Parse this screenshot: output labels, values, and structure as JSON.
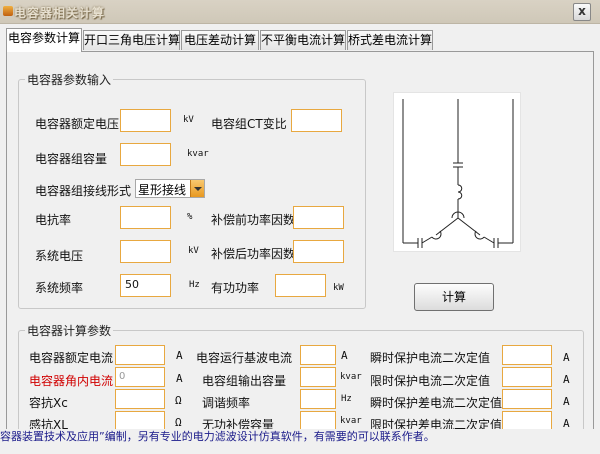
{
  "window": {
    "title": "电容器相关计算",
    "close_label": "x"
  },
  "tabs": [
    "电容参数计算",
    "开口三角电压计算",
    "电压差动计算",
    "不平衡电流计算",
    "桥式差电流计算"
  ],
  "input_group": {
    "legend": "电容器参数输入",
    "rated_voltage_label": "电容器额定电压",
    "rated_voltage_unit": "kV",
    "ct_ratio_label": "电容组CT变比",
    "capacity_label": "电容器组容量",
    "capacity_unit": "kvar",
    "wiring_label": "电容器组接线形式",
    "wiring_value": "星形接线",
    "reactance_label": "电抗率",
    "reactance_unit": "%",
    "pf_before_label": "补偿前功率因数",
    "system_voltage_label": "系统电压",
    "system_voltage_unit": "kV",
    "pf_after_label": "补偿后功率因数",
    "frequency_label": "系统频率",
    "frequency_value": "50",
    "frequency_unit": "Hz",
    "active_power_label": "有功功率",
    "active_power_unit": "kW"
  },
  "calc_button": "计算",
  "output_group": {
    "legend": "电容器计算参数",
    "rated_current_label": "电容器额定电流",
    "rated_current_unit": "A",
    "fundamental_current_label": "电容运行基波电流",
    "fundamental_current_unit": "A",
    "instant_second_label": "瞬时保护电流二次定值",
    "instant_second_unit": "A",
    "angle_current_label": "电容器角内电流",
    "angle_current_value": "0",
    "angle_current_unit": "A",
    "group_output_label": "电容组输出容量",
    "group_output_unit": "kvar",
    "limit_second_label": "限时保护电流二次定值",
    "limit_second_unit": "A",
    "xc_label": "容抗Xc",
    "xc_unit": "Ω",
    "tuning_label": "调谐频率",
    "tuning_unit": "Hz",
    "instant_diff_label": "瞬时保护差电流二次定值",
    "instant_diff_unit": "A",
    "xl_label": "感抗XL",
    "xl_unit": "Ω",
    "reactive_label": "无功补偿容量",
    "reactive_unit": "kvar",
    "limit_diff_label": "限时保护差电流二次定值",
    "limit_diff_unit": "A"
  },
  "status_text": "容器装置技术及应用”编制，另有专业的电力滤波设计仿真软件，有需要的可以联系作者。"
}
